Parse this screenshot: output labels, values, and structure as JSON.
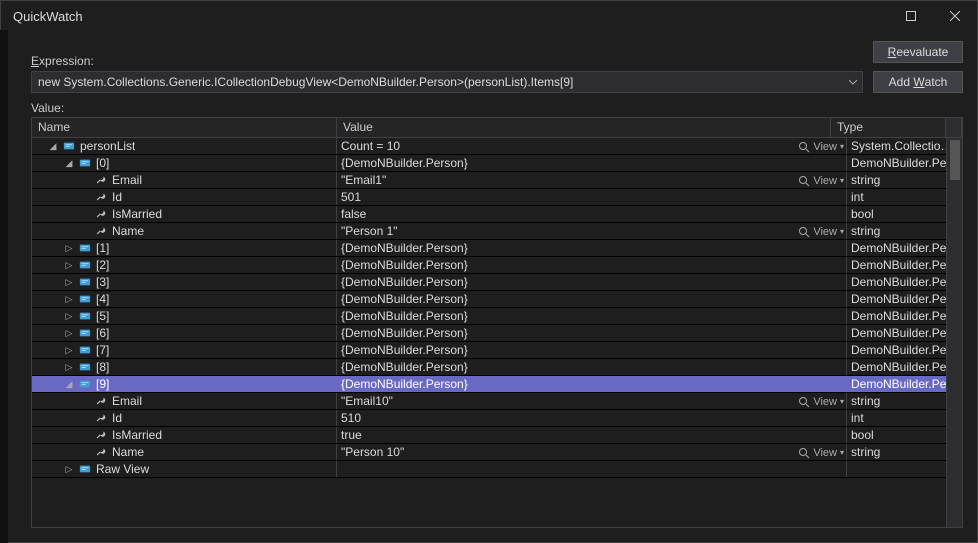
{
  "title": "QuickWatch",
  "labels": {
    "expression": "Expression:",
    "value": "Value:"
  },
  "buttons": {
    "reevaluate": "Reevaluate",
    "add_watch": "Add Watch"
  },
  "expression": {
    "value": "new System.Collections.Generic.ICollectionDebugView<DemoNBuilder.Person>(personList).Items[9]"
  },
  "columns": {
    "name": "Name",
    "value": "Value",
    "type": "Type"
  },
  "view_label": "View",
  "rows": [
    {
      "depth": 0,
      "exp": "expanded",
      "icon": "obj",
      "name": "personList",
      "value": "Count = 10",
      "type": "System.Collection...",
      "view": true,
      "selected": false
    },
    {
      "depth": 1,
      "exp": "expanded",
      "icon": "obj",
      "name": "[0]",
      "value": "{DemoNBuilder.Person}",
      "type": "DemoNBuilder.Pe...",
      "view": false,
      "selected": false
    },
    {
      "depth": 2,
      "exp": "none",
      "icon": "wrench",
      "name": "Email",
      "value": "\"Email1\"",
      "type": "string",
      "view": true,
      "pin": true,
      "selected": false
    },
    {
      "depth": 2,
      "exp": "none",
      "icon": "wrench",
      "name": "Id",
      "value": "501",
      "type": "int",
      "view": false,
      "selected": false
    },
    {
      "depth": 2,
      "exp": "none",
      "icon": "wrench",
      "name": "IsMarried",
      "value": "false",
      "type": "bool",
      "view": false,
      "selected": false
    },
    {
      "depth": 2,
      "exp": "none",
      "icon": "wrench",
      "name": "Name",
      "value": "\"Person 1\"",
      "type": "string",
      "view": true,
      "selected": false
    },
    {
      "depth": 1,
      "exp": "collapsed",
      "icon": "obj",
      "name": "[1]",
      "value": "{DemoNBuilder.Person}",
      "type": "DemoNBuilder.Pe...",
      "view": false,
      "selected": false
    },
    {
      "depth": 1,
      "exp": "collapsed",
      "icon": "obj",
      "name": "[2]",
      "value": "{DemoNBuilder.Person}",
      "type": "DemoNBuilder.Pe...",
      "view": false,
      "selected": false
    },
    {
      "depth": 1,
      "exp": "collapsed",
      "icon": "obj",
      "name": "[3]",
      "value": "{DemoNBuilder.Person}",
      "type": "DemoNBuilder.Pe...",
      "view": false,
      "selected": false
    },
    {
      "depth": 1,
      "exp": "collapsed",
      "icon": "obj",
      "name": "[4]",
      "value": "{DemoNBuilder.Person}",
      "type": "DemoNBuilder.Pe...",
      "view": false,
      "selected": false
    },
    {
      "depth": 1,
      "exp": "collapsed",
      "icon": "obj",
      "name": "[5]",
      "value": "{DemoNBuilder.Person}",
      "type": "DemoNBuilder.Pe...",
      "view": false,
      "selected": false
    },
    {
      "depth": 1,
      "exp": "collapsed",
      "icon": "obj",
      "name": "[6]",
      "value": "{DemoNBuilder.Person}",
      "type": "DemoNBuilder.Pe...",
      "view": false,
      "selected": false
    },
    {
      "depth": 1,
      "exp": "collapsed",
      "icon": "obj",
      "name": "[7]",
      "value": "{DemoNBuilder.Person}",
      "type": "DemoNBuilder.Pe...",
      "view": false,
      "selected": false
    },
    {
      "depth": 1,
      "exp": "collapsed",
      "icon": "obj",
      "name": "[8]",
      "value": "{DemoNBuilder.Person}",
      "type": "DemoNBuilder.Pe...",
      "view": false,
      "selected": false
    },
    {
      "depth": 1,
      "exp": "expanded",
      "icon": "obj",
      "name": "[9]",
      "value": "{DemoNBuilder.Person}",
      "type": "DemoNBuilder.Pe...",
      "view": false,
      "selected": true
    },
    {
      "depth": 2,
      "exp": "none",
      "icon": "wrench",
      "name": "Email",
      "value": "\"Email10\"",
      "type": "string",
      "view": true,
      "selected": false
    },
    {
      "depth": 2,
      "exp": "none",
      "icon": "wrench",
      "name": "Id",
      "value": "510",
      "type": "int",
      "view": false,
      "selected": false
    },
    {
      "depth": 2,
      "exp": "none",
      "icon": "wrench",
      "name": "IsMarried",
      "value": "true",
      "type": "bool",
      "view": false,
      "selected": false
    },
    {
      "depth": 2,
      "exp": "none",
      "icon": "wrench",
      "name": "Name",
      "value": "\"Person 10\"",
      "type": "string",
      "view": true,
      "selected": false
    },
    {
      "depth": 1,
      "exp": "collapsed",
      "icon": "obj",
      "name": "Raw View",
      "value": "",
      "type": "",
      "view": false,
      "selected": false
    }
  ]
}
